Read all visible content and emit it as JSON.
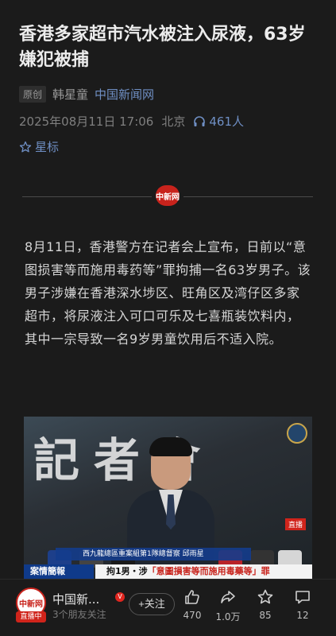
{
  "article": {
    "title": "香港多家超市汽水被注入尿液，63岁嫌犯被捕",
    "original_badge": "原创",
    "author": "韩星童",
    "source": "中国新闻网",
    "datetime": "2025年08月11日 17:06",
    "location": "北京",
    "listeners": "461人",
    "star_label": "星标",
    "divider_logo": "中新网",
    "body": "8月11日，香港警方在记者会上宣布，日前以“意图损害等而施用毒药等”罪拘捕一名63岁男子。该男子涉嫌在香港深水埗区、旺角区及湾仔区多家超市，将尿液注入可口可乐及七喜瓶装饮料内，其中一宗导致一名9岁男童饮用后不适入院。"
  },
  "video": {
    "bg_text": "記者會",
    "live_tag": "直播",
    "caption_top": "西九龍總區重案組第1隊總督察 邱雨星",
    "caption_left": "案情簡報",
    "caption_main_prefix": "拘1男・涉",
    "caption_main_highlight": "「意圖損害等而施用毒藥等」罪"
  },
  "bottom": {
    "avatar_text": "中新网",
    "live_pill": "直播中",
    "account_name": "中国新...",
    "verified_mark": "V",
    "sub": "3个朋友关注",
    "follow": "+关注",
    "likes": "470",
    "shares": "1.0万",
    "favorites": "85",
    "comments": "12"
  },
  "colors": {
    "background": "#1b1b1b",
    "link_blue": "#6f8fc4",
    "brand_red": "#c8231c"
  },
  "icons": [
    "headphones-icon",
    "star-icon",
    "thumb-up-icon",
    "share-icon",
    "favorite-icon",
    "comment-icon",
    "verified-icon"
  ]
}
